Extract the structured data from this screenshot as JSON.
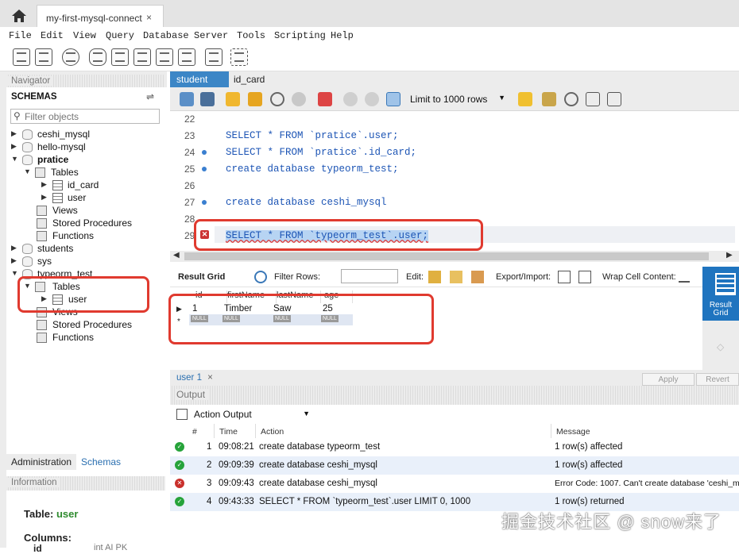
{
  "window": {
    "tab_title": "my-first-mysql-connect",
    "close_glyph": "×"
  },
  "menu": [
    "File",
    "Edit",
    "View",
    "Query",
    "Database",
    "Server",
    "Tools",
    "Scripting",
    "Help"
  ],
  "navigator": {
    "header": "Navigator",
    "schemas_label": "SCHEMAS",
    "filter_placeholder": "Filter objects",
    "tree": [
      {
        "label": "ceshi_mysql"
      },
      {
        "label": "hello-mysql"
      },
      {
        "label": "pratice"
      },
      {
        "label": "Tables"
      },
      {
        "label": "id_card"
      },
      {
        "label": "user"
      },
      {
        "label": "Views"
      },
      {
        "label": "Stored Procedures"
      },
      {
        "label": "Functions"
      },
      {
        "label": "students"
      },
      {
        "label": "sys"
      },
      {
        "label": "typeorm_test"
      },
      {
        "label": "Tables"
      },
      {
        "label": "user"
      },
      {
        "label": "Views"
      },
      {
        "label": "Stored Procedures"
      },
      {
        "label": "Functions"
      }
    ],
    "bottom_tabs": [
      "Administration",
      "Schemas"
    ],
    "info_header": "Information",
    "info": {
      "table_label": "Table:",
      "table_name": "user",
      "columns_label": "Columns:",
      "col_id": "id",
      "col_id_type": "int AI PK"
    }
  },
  "editor": {
    "tabs": [
      "student",
      "id_card"
    ],
    "limit": "Limit to 1000 rows",
    "lines": [
      {
        "n": "22",
        "code": ""
      },
      {
        "n": "23",
        "code": "SELECT * FROM `pratice`.user;"
      },
      {
        "n": "24",
        "code": "SELECT * FROM `pratice`.id_card;"
      },
      {
        "n": "25",
        "code": "create database typeorm_test;"
      },
      {
        "n": "26",
        "code": ""
      },
      {
        "n": "27",
        "code": "create database ceshi_mysql"
      },
      {
        "n": "28",
        "code": ""
      },
      {
        "n": "29",
        "code": "SELECT * FROM `typeorm_test`.user;"
      }
    ],
    "error_glyph": "✕"
  },
  "results": {
    "result_grid_label": "Result Grid",
    "filter_rows_label": "Filter Rows:",
    "edit_label": "Edit:",
    "export_label": "Export/Import:",
    "wrap_label": "Wrap Cell Content:",
    "columns": [
      "id",
      "firstName",
      "lastName",
      "age"
    ],
    "rows": [
      [
        "1",
        "Timber",
        "Saw",
        "25"
      ]
    ],
    "null_label": "NULL",
    "side_button": "Result Grid",
    "result_tab": "user 1",
    "apply": "Apply",
    "revert": "Revert"
  },
  "output": {
    "header": "Output",
    "selector": "Action Output",
    "columns": [
      "#",
      "Time",
      "Action",
      "Message"
    ],
    "rows": [
      {
        "status": "ok",
        "n": "1",
        "time": "09:08:21",
        "action": "create database typeorm_test",
        "message": "1 row(s) affected"
      },
      {
        "status": "ok",
        "n": "2",
        "time": "09:09:39",
        "action": "create database ceshi_mysql",
        "message": "1 row(s) affected"
      },
      {
        "status": "error",
        "n": "3",
        "time": "09:09:43",
        "action": "create database ceshi_mysql",
        "message": "Error Code: 1007. Can't create database 'ceshi_m"
      },
      {
        "status": "ok",
        "n": "4",
        "time": "09:43:33",
        "action": "SELECT * FROM `typeorm_test`.user LIMIT 0, 1000",
        "message": "1 row(s) returned"
      }
    ]
  },
  "watermark": "掘金技术社区 @ snow来了",
  "colors": {
    "accent": "#3c86c6",
    "annotation": "#e03a2f",
    "ok": "#26a33a",
    "error": "#c9302c"
  }
}
